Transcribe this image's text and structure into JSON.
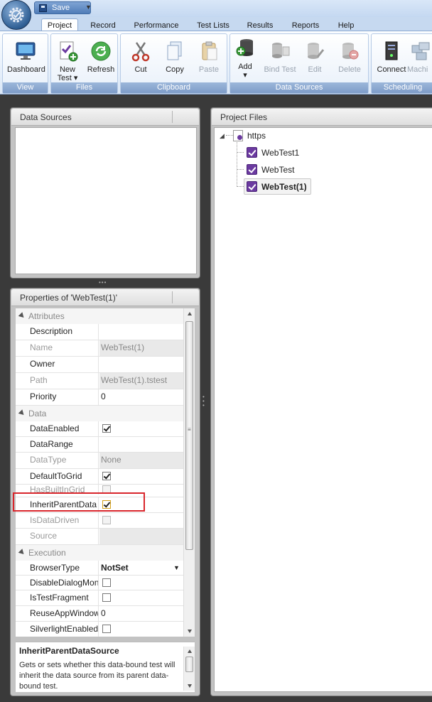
{
  "quick_access": {
    "save_label": "Save"
  },
  "ribbon_tabs": [
    "Project",
    "Record",
    "Performance",
    "Test Lists",
    "Results",
    "Reports",
    "Help"
  ],
  "ribbon": {
    "groups": {
      "view": "View",
      "files": "Files",
      "clipboard": "Clipboard",
      "data_sources": "Data Sources",
      "scheduling": "Scheduling"
    },
    "buttons": {
      "dashboard": "Dashboard",
      "new_test_line1": "New",
      "new_test_line2": "Test",
      "refresh": "Refresh",
      "cut": "Cut",
      "copy": "Copy",
      "paste": "Paste",
      "add": "Add",
      "bind_test": "Bind Test",
      "edit": "Edit",
      "delete": "Delete",
      "connect": "Connect",
      "machines": "Machi"
    }
  },
  "data_sources_panel": {
    "title": "Data Sources"
  },
  "properties_panel": {
    "title": "Properties of 'WebTest(1)'",
    "categories": {
      "attributes": "Attributes",
      "data": "Data",
      "execution": "Execution"
    },
    "rows": [
      {
        "name": "Description",
        "value": ""
      },
      {
        "name": "Name",
        "value": "WebTest(1)"
      },
      {
        "name": "Owner",
        "value": ""
      },
      {
        "name": "Path",
        "value": "WebTest(1).tstest"
      },
      {
        "name": "Priority",
        "value": "0"
      },
      {
        "name": "DataEnabled",
        "value": ""
      },
      {
        "name": "DataRange",
        "value": ""
      },
      {
        "name": "DataType",
        "value": "None"
      },
      {
        "name": "DefaultToGrid",
        "value": ""
      },
      {
        "name": "HasBuiltInGrid",
        "value": ""
      },
      {
        "name": "InheritParentData",
        "value": ""
      },
      {
        "name": "IsDataDriven",
        "value": ""
      },
      {
        "name": "Source",
        "value": ""
      },
      {
        "name": "BrowserType",
        "value": "NotSet"
      },
      {
        "name": "DisableDialogMon",
        "value": ""
      },
      {
        "name": "IsTestFragment",
        "value": ""
      },
      {
        "name": "ReuseAppWindow",
        "value": "0"
      },
      {
        "name": "SilverlightEnabled",
        "value": ""
      }
    ],
    "checkboxes": {
      "DataEnabled": true,
      "DefaultToGrid": true,
      "HasBuiltInGrid": false,
      "InheritParentData": true,
      "IsDataDriven": false,
      "DisableDialogMon": false,
      "IsTestFragment": false,
      "SilverlightEnabled": false
    },
    "description": {
      "title": "InheritParentDataSource",
      "text": "Gets or sets whether this data-bound test will inherit the data source from its parent data-bound test."
    }
  },
  "project_files_panel": {
    "title": "Project Files",
    "root": "https",
    "items": [
      "WebTest1",
      "WebTest",
      "WebTest(1)"
    ],
    "selected": "WebTest(1)"
  },
  "colors": {
    "highlight_box": "#d9262c",
    "test_icon": "#6b3aa0",
    "ribbon_group_label": "#7e9cc8"
  }
}
